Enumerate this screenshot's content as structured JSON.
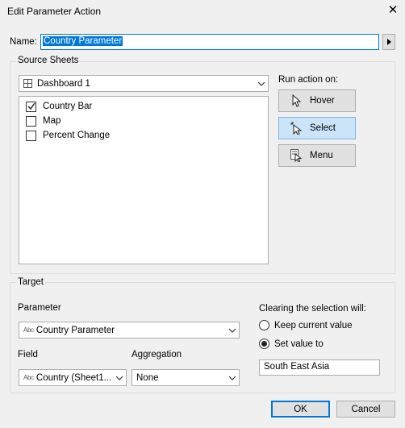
{
  "window": {
    "title": "Edit Parameter Action",
    "close_glyph": "✕"
  },
  "name": {
    "label": "Name:",
    "value": "Country Parameter"
  },
  "source_sheets": {
    "group_label": "Source Sheets",
    "dashboard": "Dashboard 1",
    "sheets": [
      {
        "label": "Country Bar",
        "checked": true
      },
      {
        "label": "Map",
        "checked": false
      },
      {
        "label": "Percent Change",
        "checked": false
      }
    ]
  },
  "run_action": {
    "label": "Run action on:",
    "buttons": [
      {
        "label": "Hover",
        "icon": "pointer-icon",
        "selected": false
      },
      {
        "label": "Select",
        "icon": "select-pointer-icon",
        "selected": true
      },
      {
        "label": "Menu",
        "icon": "menu-pointer-icon",
        "selected": false
      }
    ]
  },
  "target": {
    "group_label": "Target",
    "parameter_label": "Parameter",
    "parameter_value": "Country Parameter",
    "field_label": "Field",
    "field_value": "Country (Sheet1...",
    "aggregation_label": "Aggregation",
    "aggregation_value": "None",
    "abc_tag": "Abc"
  },
  "clearing": {
    "label": "Clearing the selection will:",
    "options": [
      {
        "label": "Keep current value",
        "selected": false
      },
      {
        "label": "Set value to",
        "selected": true
      }
    ],
    "set_value": "South East Asia"
  },
  "footer": {
    "ok": "OK",
    "cancel": "Cancel"
  }
}
